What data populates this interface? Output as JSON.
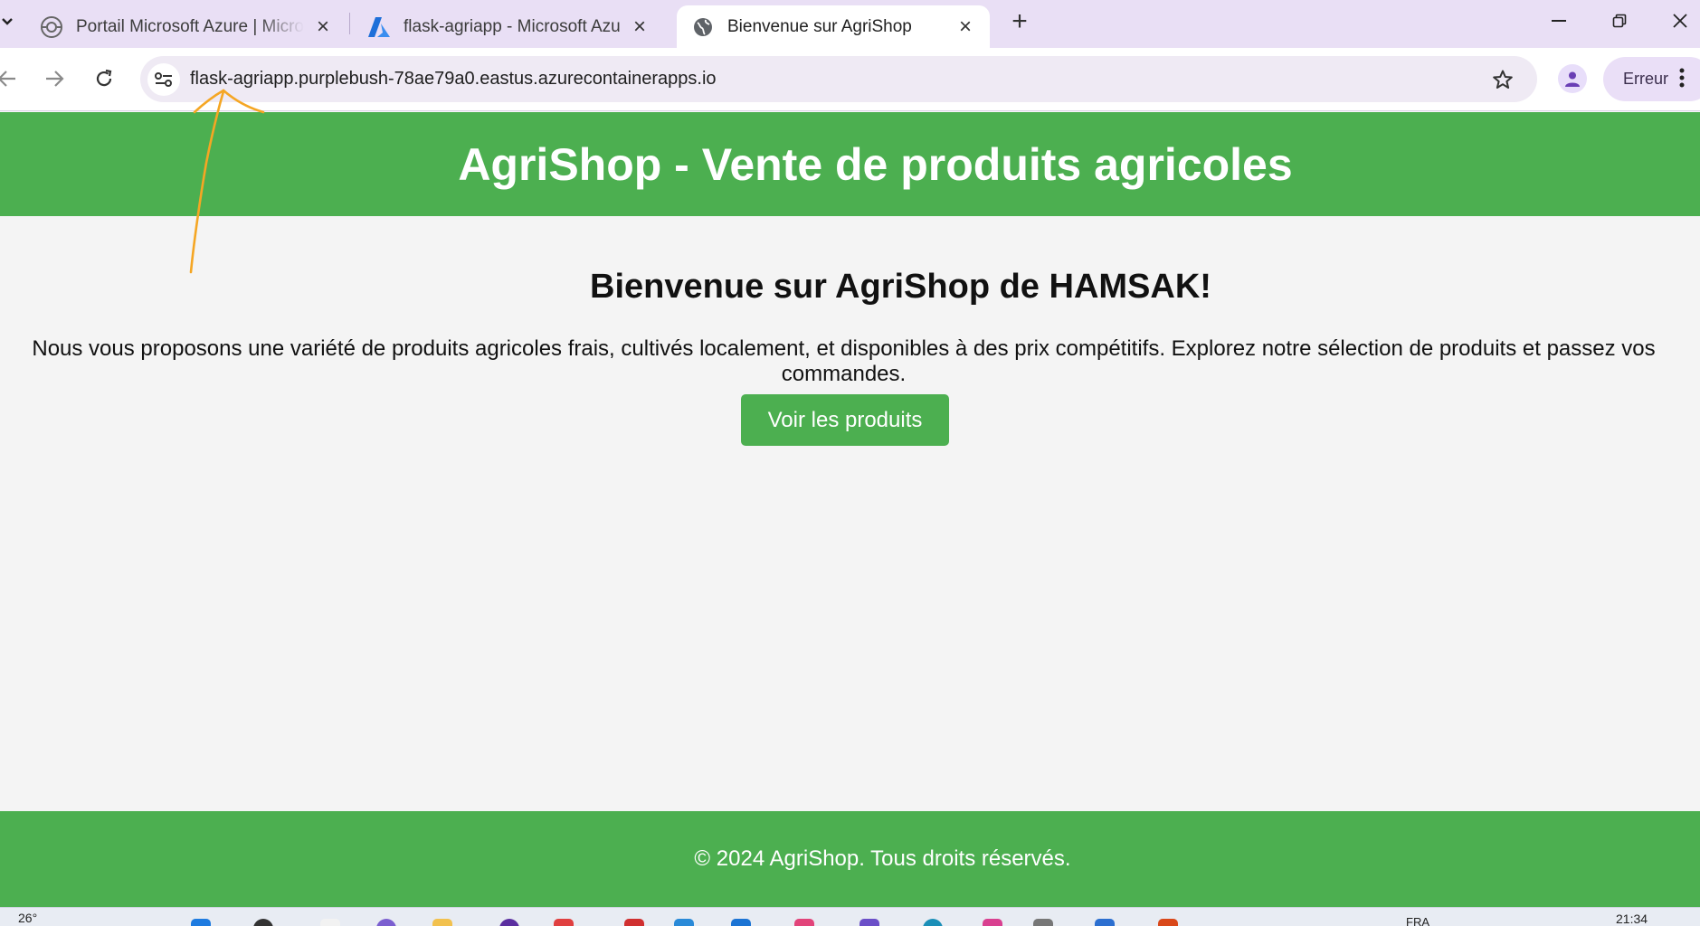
{
  "browser": {
    "tabs": [
      {
        "title": "Portail Microsoft Azure | Microsoft Azure",
        "icon": "azure-portal-globe-icon"
      },
      {
        "title": "flask-agriapp - Microsoft Azure",
        "icon": "azure-logo-icon"
      },
      {
        "title": "Bienvenue sur AgriShop",
        "icon": "globe-icon",
        "active": true
      }
    ],
    "url": "flask-agriapp.purplebush-78ae79a0.eastus.azurecontainerapps.io",
    "profile_status": "Erreur"
  },
  "page": {
    "header_title": "AgriShop - Vente de produits agricoles",
    "welcome_heading": "Bienvenue sur AgriShop de HAMSAK!",
    "intro_text": "Nous vous proposons une variété de produits agricoles frais, cultivés localement, et disponibles à des prix compétitifs. Explorez notre sélection de produits et passez vos commandes.",
    "cta_label": "Voir les produits",
    "footer_text": "© 2024 AgriShop. Tous droits réservés."
  },
  "taskbar": {
    "temperature": "26°",
    "language": "FRA",
    "time": "21:34"
  },
  "colors": {
    "brand_green": "#4caf50",
    "tab_strip": "#e9dff5",
    "annotation": "#f5a623"
  }
}
